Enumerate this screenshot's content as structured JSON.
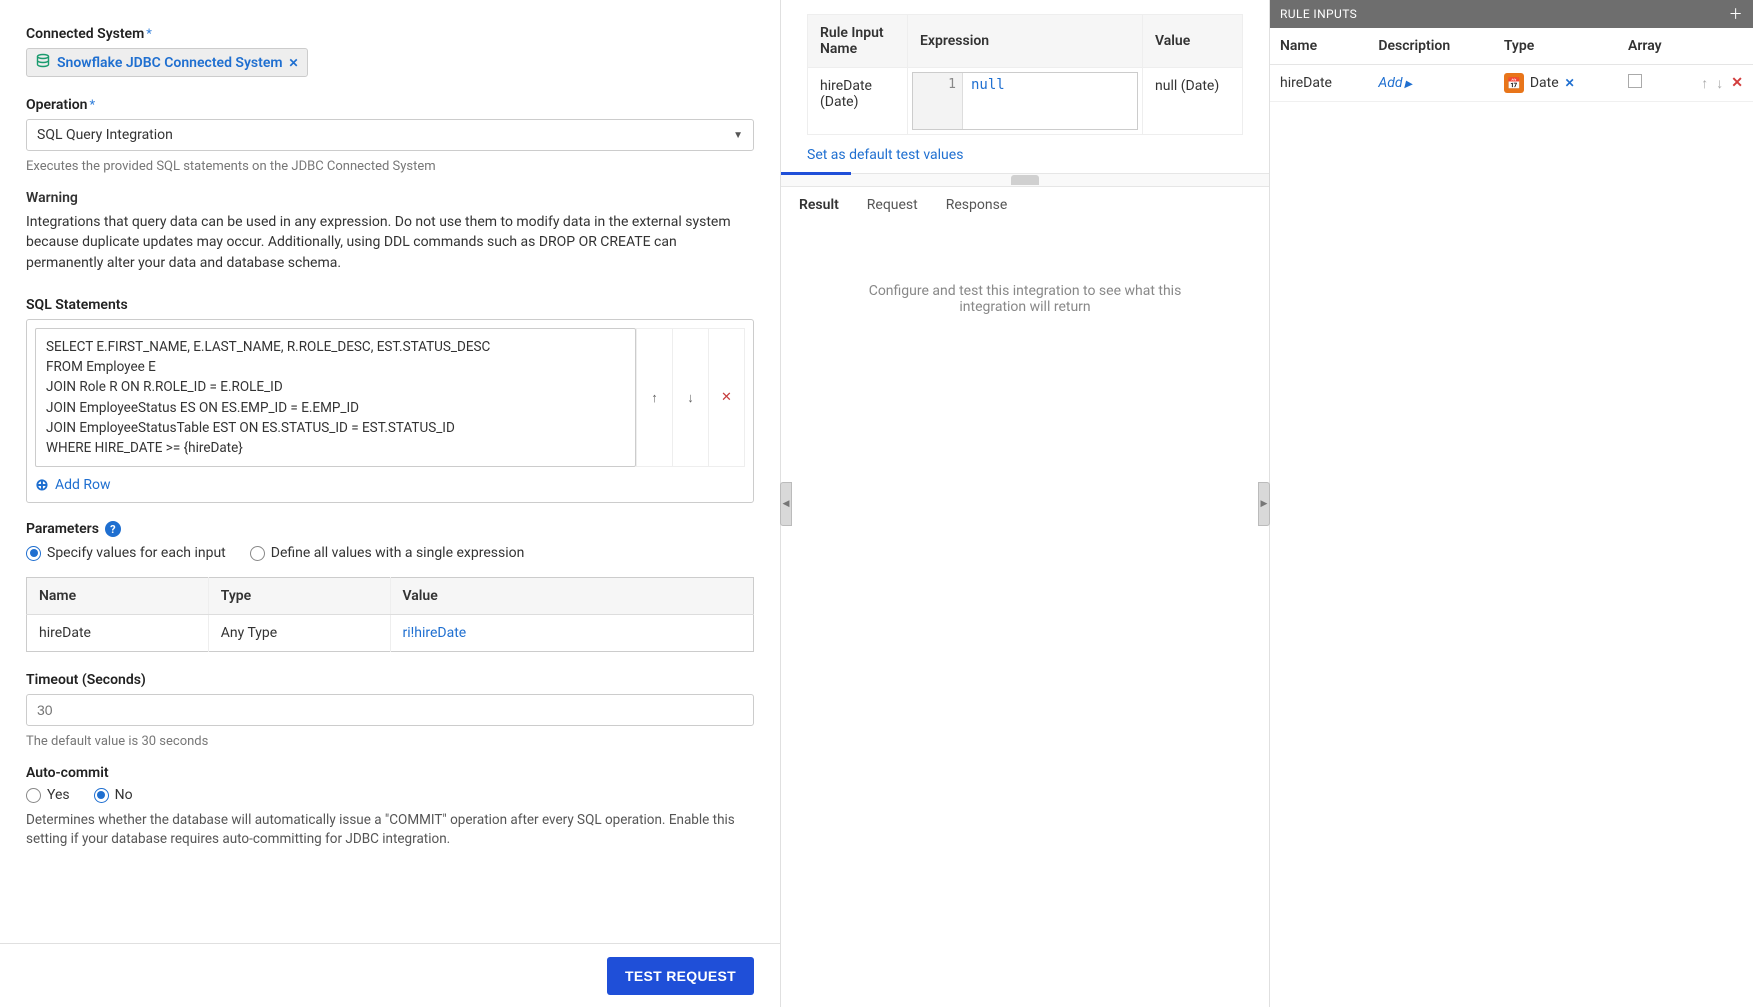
{
  "left": {
    "connected_system_label": "Connected System",
    "chip_text": "Snowflake JDBC Connected System",
    "operation_label": "Operation",
    "operation_value": "SQL Query Integration",
    "operation_helper": "Executes the provided SQL statements on the JDBC Connected System",
    "warning_title": "Warning",
    "warning_text": "Integrations that query data can be used in any expression. Do not use them to modify data in the external system because duplicate updates may occur. Additionally, using DDL commands such as DROP OR CREATE can permanently alter your data and database schema.",
    "sql_label": "SQL Statements",
    "sql_text": "SELECT E.FIRST_NAME, E.LAST_NAME, R.ROLE_DESC, EST.STATUS_DESC\nFROM Employee E\nJOIN Role R ON R.ROLE_ID = E.ROLE_ID\nJOIN EmployeeStatus ES ON ES.EMP_ID = E.EMP_ID\nJOIN EmployeeStatusTable EST ON ES.STATUS_ID = EST.STATUS_ID\nWHERE HIRE_DATE >= {hireDate}",
    "add_row": "Add Row",
    "parameters_label": "Parameters",
    "radio_specify": "Specify values for each input",
    "radio_define": "Define all values with a single expression",
    "param_headers": {
      "name": "Name",
      "type": "Type",
      "value": "Value"
    },
    "param_row": {
      "name": "hireDate",
      "type": "Any Type",
      "value": "ri!hireDate"
    },
    "timeout_label": "Timeout (Seconds)",
    "timeout_placeholder": "30",
    "timeout_note": "The default value is 30 seconds",
    "autocommit_label": "Auto-commit",
    "radio_yes": "Yes",
    "radio_no": "No",
    "autocommit_desc": "Determines whether the database will automatically issue a \"COMMIT\" operation after every SQL operation. Enable this setting if your database requires auto-committing for JDBC integration.",
    "test_button": "TEST REQUEST"
  },
  "center": {
    "headers": {
      "name": "Rule Input Name",
      "expr": "Expression",
      "value": "Value"
    },
    "row": {
      "name": "hireDate (Date)",
      "gutter": "1",
      "expr": "null",
      "value": "null (Date)"
    },
    "set_default": "Set as default test values",
    "tabs": {
      "result": "Result",
      "request": "Request",
      "response": "Response"
    },
    "result_placeholder": "Configure and test this integration to see what this integration will return"
  },
  "right": {
    "header": "RULE INPUTS",
    "headers": {
      "name": "Name",
      "desc": "Description",
      "type": "Type",
      "array": "Array"
    },
    "row": {
      "name": "hireDate",
      "desc": "Add",
      "type": "Date"
    }
  }
}
